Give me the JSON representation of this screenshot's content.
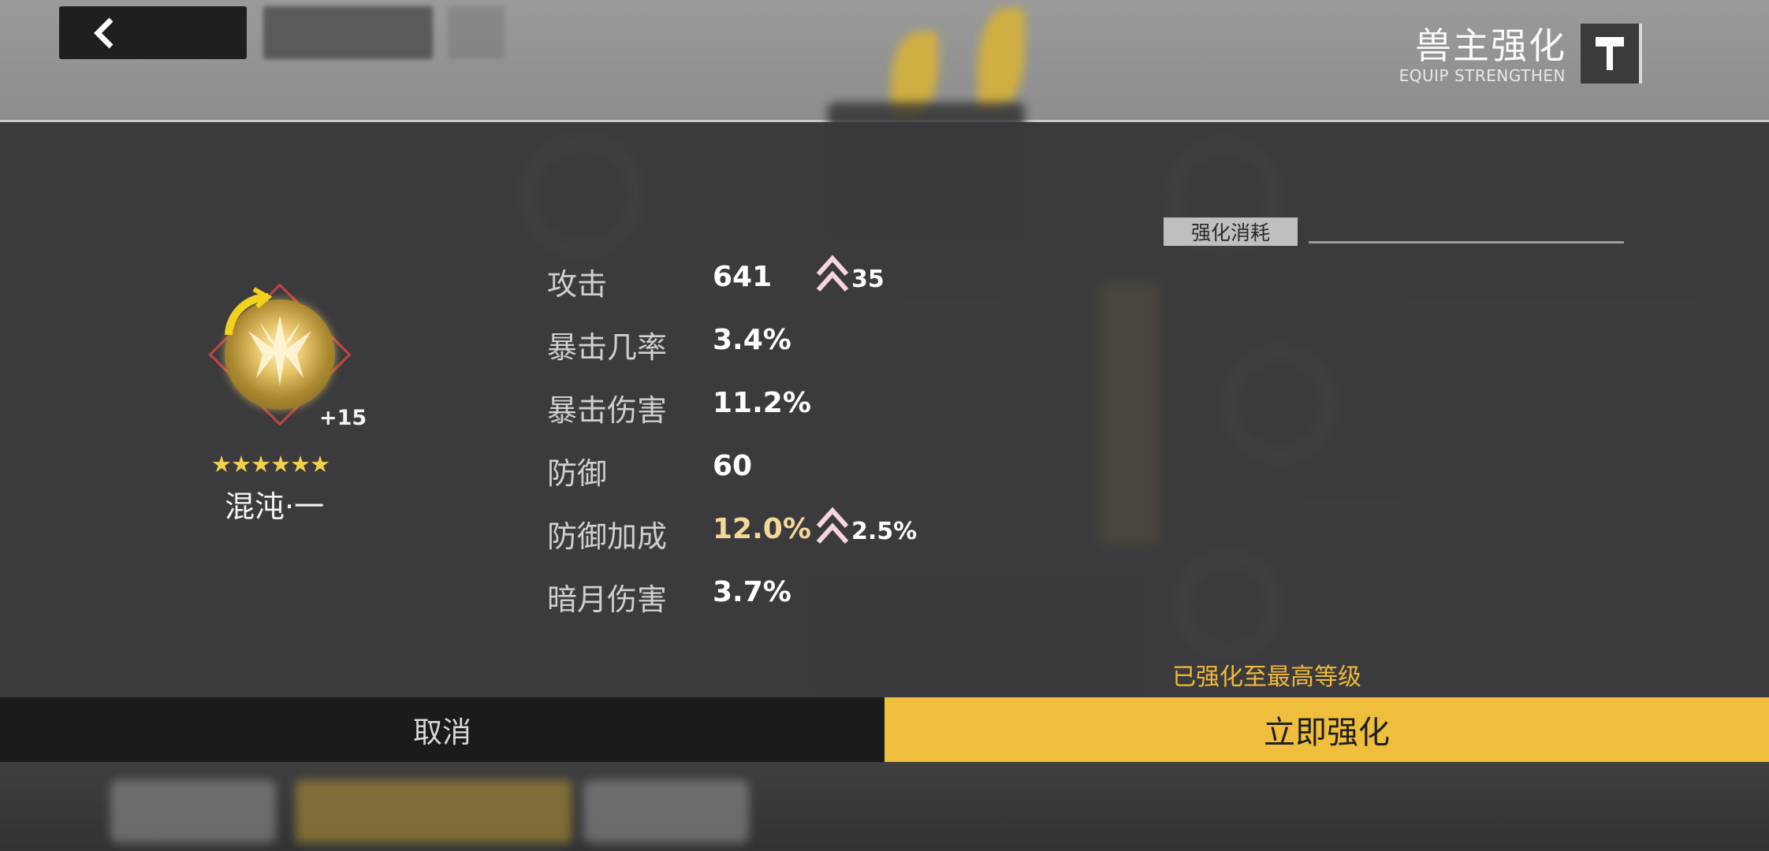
{
  "header": {
    "title": "兽主强化",
    "subtitle": "EQUIP STRENGTHEN",
    "back_icon": "chevron-left-icon",
    "title_icon": "hammer-icon"
  },
  "item": {
    "icon": "beast-emblem-icon",
    "level": "+15",
    "stars": "★★★★★★",
    "star_count": 6,
    "name": "混沌·一"
  },
  "stats": [
    {
      "label": "攻击",
      "value": "641",
      "increase": "35",
      "highlight": false
    },
    {
      "label": "暴击几率",
      "value": "3.4%",
      "increase": "",
      "highlight": false
    },
    {
      "label": "暴击伤害",
      "value": "11.2%",
      "increase": "",
      "highlight": false
    },
    {
      "label": "防御",
      "value": "60",
      "increase": "",
      "highlight": false
    },
    {
      "label": "防御加成",
      "value": "12.0%",
      "increase": "2.5%",
      "highlight": true
    },
    {
      "label": "暗月伤害",
      "value": "3.7%",
      "increase": "",
      "highlight": false
    }
  ],
  "cost": {
    "label": "强化消耗"
  },
  "status": {
    "max_level_message": "已强化至最高等级"
  },
  "actions": {
    "cancel_label": "取消",
    "confirm_label": "立即强化"
  },
  "colors": {
    "accent_gold": "#efbe3c",
    "warning_text": "#f0b93a",
    "highlight_value": "#f4d898",
    "star": "#f3cf4e"
  }
}
